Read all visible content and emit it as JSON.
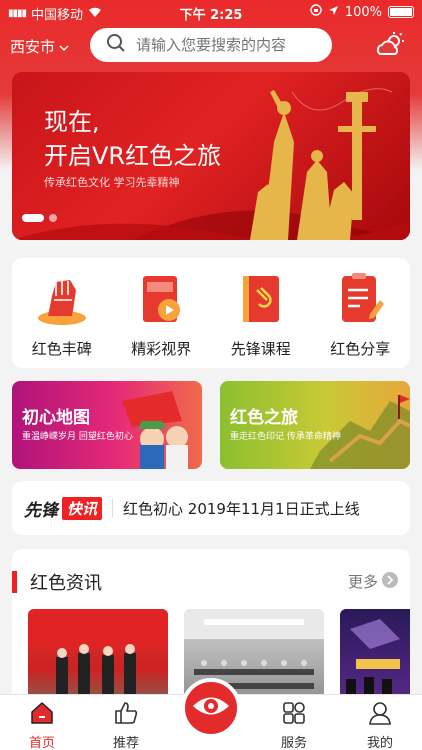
{
  "status": {
    "carrier": "中国移动",
    "time": "下午 2:25",
    "battery": "100%"
  },
  "topbar": {
    "city": "西安市",
    "search_placeholder": "请输入您要搜索的内容"
  },
  "banner": {
    "line1": "现在,",
    "line2": "开启VR红色之旅",
    "sub": "传承红色文化  学习先辈精神",
    "page_index": 1,
    "page_count": 2
  },
  "quick": [
    {
      "label": "红色丰碑",
      "icon": "raised-fist-icon"
    },
    {
      "label": "精彩视界",
      "icon": "video-book-icon"
    },
    {
      "label": "先锋课程",
      "icon": "party-book-icon"
    },
    {
      "label": "红色分享",
      "icon": "document-edit-icon"
    }
  ],
  "promos": [
    {
      "title": "初心地图",
      "sub": "重温峥嵘岁月  回望红色初心"
    },
    {
      "title": "红色之旅",
      "sub": "重走红色印记  传承革命精神"
    }
  ],
  "news": {
    "brand1": "先锋",
    "brand2": "快讯",
    "text": "红色初心 2019年11月1日正式上线"
  },
  "info": {
    "title": "红色资讯",
    "more": "更多"
  },
  "tabs": [
    {
      "label": "首页",
      "icon": "home-icon",
      "active": true
    },
    {
      "label": "推荐",
      "icon": "thumbs-up-icon"
    },
    {
      "label": "服务",
      "icon": "grid-apps-icon"
    },
    {
      "label": "我的",
      "icon": "user-icon"
    }
  ],
  "center_button": {
    "icon": "eye-icon"
  },
  "colors": {
    "primary": "#e32b2b",
    "gold": "#f2c24a"
  }
}
